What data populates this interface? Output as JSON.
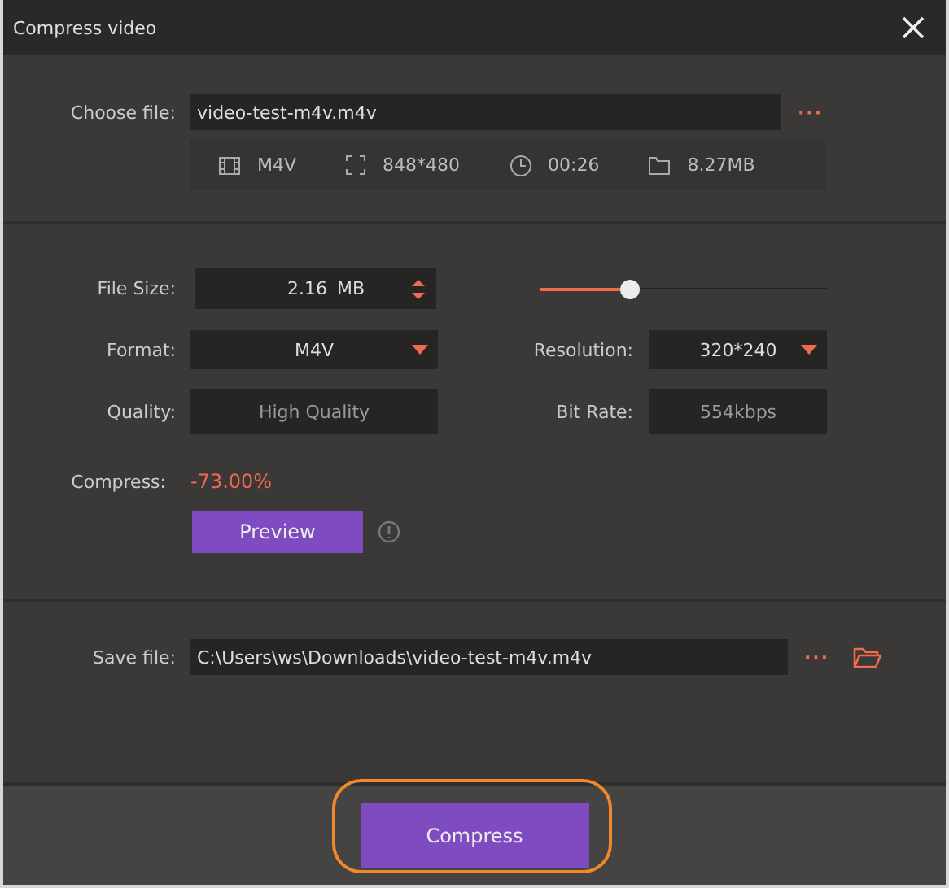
{
  "window": {
    "title": "Compress video"
  },
  "source": {
    "label": "Choose file:",
    "value": "video-test-m4v.m4v",
    "more": "···",
    "info": [
      {
        "kind": "film",
        "text": "M4V"
      },
      {
        "kind": "resolution",
        "text": "848*480"
      },
      {
        "kind": "duration",
        "text": "00:26"
      },
      {
        "kind": "size",
        "text": "8.27MB"
      }
    ]
  },
  "settings": {
    "file_size": {
      "label": "File Size:",
      "value": "2.16",
      "unit": "MB"
    },
    "slider": {
      "level": 0.31
    },
    "format": {
      "label": "Format:",
      "value": "M4V"
    },
    "resolution": {
      "label": "Resolution:",
      "value": "320*240"
    },
    "quality": {
      "label": "Quality:",
      "value": "High Quality"
    },
    "bit_rate": {
      "label": "Bit Rate:",
      "value": "554kbps"
    },
    "compress": {
      "label": "Compress:",
      "value": "-73.00%"
    },
    "preview_button": "Preview"
  },
  "save": {
    "label": "Save file:",
    "value": "C:\\Users\\ws\\Downloads\\video-test-m4v.m4v",
    "more": "···"
  },
  "footer": {
    "button": {
      "label": "Compress",
      "highlighted": true
    }
  }
}
